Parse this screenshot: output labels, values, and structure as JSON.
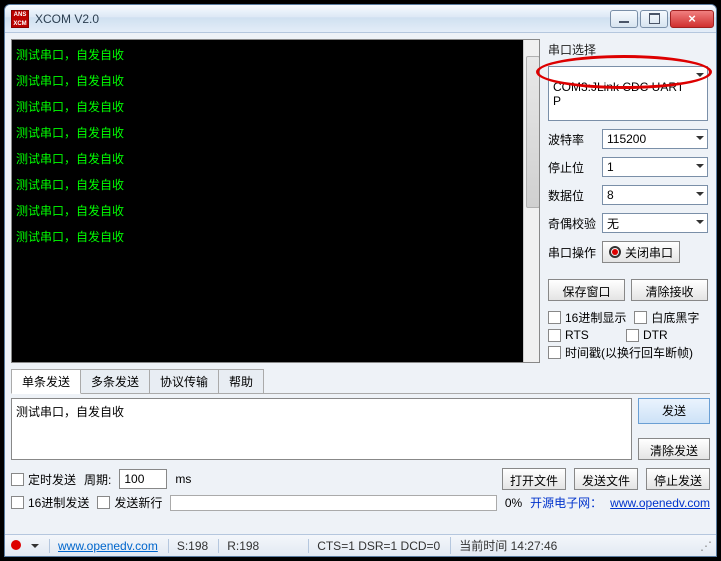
{
  "title": "XCOM V2.0",
  "console_lines": [
    "测试串口，自发自收",
    "测试串口，自发自收",
    "测试串口，自发自收",
    "测试串口，自发自收",
    "测试串口，自发自收",
    "测试串口，自发自收",
    "测试串口，自发自收",
    "测试串口，自发自收"
  ],
  "side": {
    "port_label": "串口选择",
    "port_value": "COM3:JLink CDC UART P",
    "baud_label": "波特率",
    "baud_value": "115200",
    "stop_label": "停止位",
    "stop_value": "1",
    "data_label": "数据位",
    "data_value": "8",
    "parity_label": "奇偶校验",
    "parity_value": "无",
    "action_label": "串口操作",
    "close_btn": "关闭串口",
    "save_window": "保存窗口",
    "clear_recv": "清除接收",
    "hex_display": "16进制显示",
    "white_bg": "白底黑字",
    "rts": "RTS",
    "dtr": "DTR",
    "timestamp": "时间戳(以换行回车断帧)"
  },
  "tabs": [
    "单条发送",
    "多条发送",
    "协议传输",
    "帮助"
  ],
  "send_text": "测试串口，自发自收",
  "send_btn": "发送",
  "clear_send": "清除发送",
  "timed_send": "定时发送",
  "period_label": "周期:",
  "period_value": "100",
  "period_unit": "ms",
  "open_file": "打开文件",
  "send_file": "发送文件",
  "stop_send": "停止发送",
  "hex_send": "16进制发送",
  "send_newline": "发送新行",
  "progress_pct": "0%",
  "promo_label": "开源电子网：",
  "promo_url": "www.openedv.com",
  "status": {
    "site": "www.openedv.com",
    "s": "S:198",
    "r": "R:198",
    "cts": "CTS=1 DSR=1 DCD=0",
    "time_label": "当前时间",
    "time": "14:27:46"
  }
}
